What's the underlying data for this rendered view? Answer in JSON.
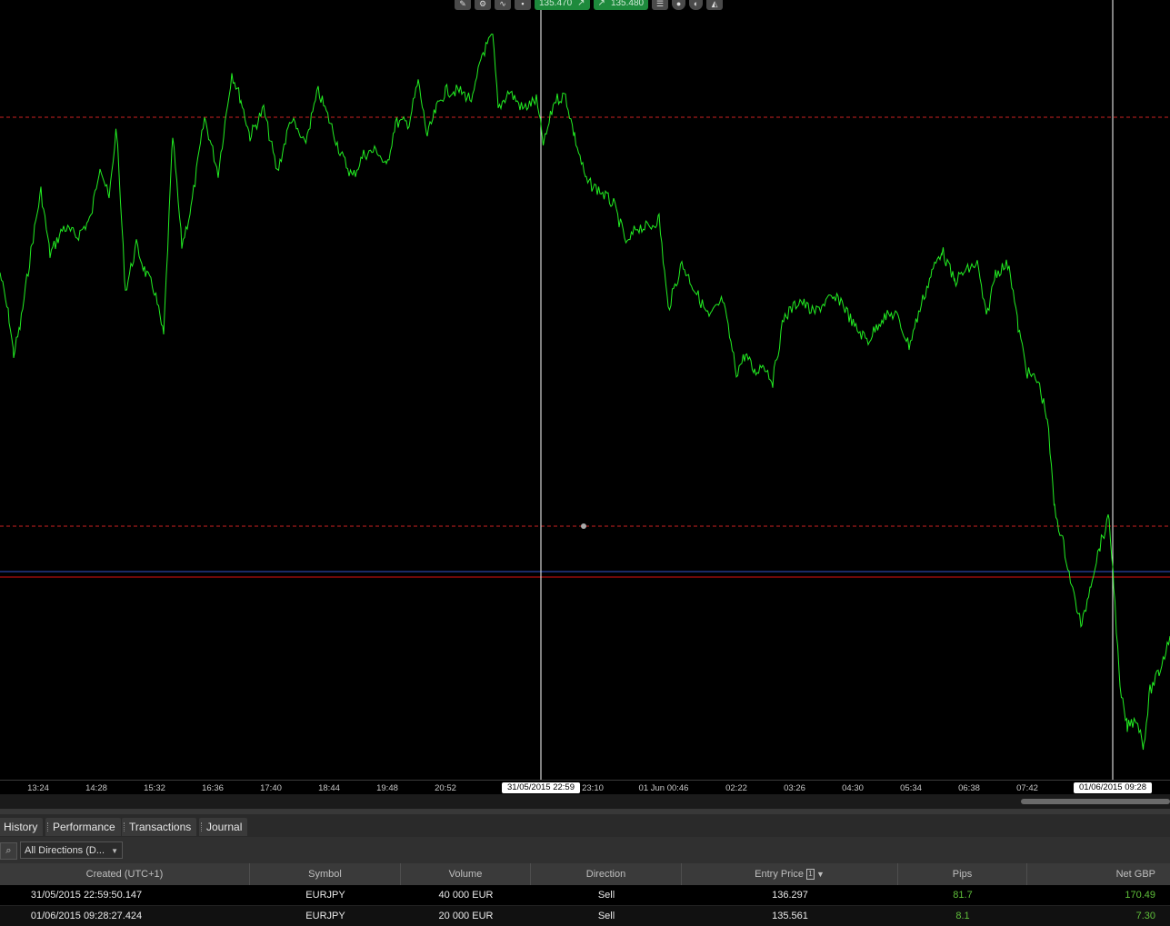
{
  "chart": {
    "toolbar": {
      "icons": [
        "tools-icon",
        "settings-icon",
        "chart-type-icon",
        "timeframe-icon"
      ],
      "sell_price": "135.470",
      "buy_price": "135.480",
      "right_icons": [
        "list-icon",
        "camera-icon",
        "paint-icon",
        "snapshot-icon"
      ]
    },
    "colors": {
      "price_line": "#22ee22",
      "crosshair": "#ffffff",
      "level_dashed": "#cc2222",
      "level_solid_red": "#dd1111",
      "level_solid_blue": "#3355cc",
      "background": "#000000"
    },
    "time_ticks": [
      "13:24",
      "14:28",
      "15:32",
      "16:36",
      "17:40",
      "18:44",
      "19:48",
      "20:52",
      "23:10",
      "01 Jun 00:46",
      "02:22",
      "03:26",
      "04:30",
      "05:34",
      "06:38",
      "07:42"
    ],
    "crosshair_labels": [
      "31/05/2015 22:59",
      "01/06/2015 09:28"
    ]
  },
  "tabs": [
    {
      "label": "History"
    },
    {
      "label": "Performance"
    },
    {
      "label": "Transactions"
    },
    {
      "label": "Journal"
    }
  ],
  "filter": {
    "direction_value": "All Directions (D..."
  },
  "table": {
    "columns": [
      "Created (UTC+1)",
      "Symbol",
      "Volume",
      "Direction",
      "Entry Price",
      "Pips",
      "Net GBP"
    ],
    "sort_indicator": "1",
    "sort_arrow": "▼",
    "rows": [
      {
        "created": "31/05/2015 22:59:50.147",
        "symbol": "EURJPY",
        "volume": "40 000 EUR",
        "direction": "Sell",
        "entry_price": "136.297",
        "pips": "81.7",
        "net": "170.49"
      },
      {
        "created": "01/06/2015 09:28:27.424",
        "symbol": "EURJPY",
        "volume": "20 000 EUR",
        "direction": "Sell",
        "entry_price": "135.561",
        "pips": "8.1",
        "net": "7.30"
      }
    ]
  }
}
